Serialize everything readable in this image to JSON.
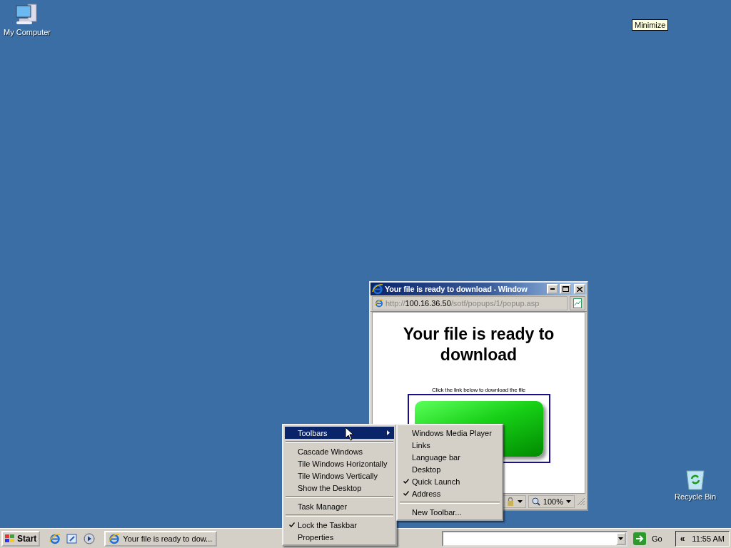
{
  "desktop_icons": [
    {
      "label": "My Computer",
      "kind": "computer"
    },
    {
      "label": "Recycle Bin",
      "kind": "recycle"
    }
  ],
  "tooltip": {
    "text": "Minimize"
  },
  "popup_window": {
    "title": "Your file is ready to download - Window",
    "address": "http://**100.16.36.50**/sotf/popups/1/popup.asp",
    "heading": "Your file is ready to download",
    "instruction": "Click the link below to download the file",
    "zoom": "100%"
  },
  "context_menu": {
    "items": [
      {
        "kind": "item",
        "label": "Toolbars",
        "selected": true,
        "checked": false,
        "submenu": true
      },
      {
        "kind": "separator"
      },
      {
        "kind": "item",
        "label": "Cascade Windows",
        "selected": false,
        "checked": false,
        "submenu": false
      },
      {
        "kind": "item",
        "label": "Tile Windows Horizontally",
        "selected": false,
        "checked": false,
        "submenu": false
      },
      {
        "kind": "item",
        "label": "Tile Windows Vertically",
        "selected": false,
        "checked": false,
        "submenu": false
      },
      {
        "kind": "item",
        "label": "Show the Desktop",
        "selected": false,
        "checked": false,
        "submenu": false
      },
      {
        "kind": "separator"
      },
      {
        "kind": "item",
        "label": "Task Manager",
        "selected": false,
        "checked": false,
        "submenu": false
      },
      {
        "kind": "separator"
      },
      {
        "kind": "item",
        "label": "Lock the Taskbar",
        "selected": false,
        "checked": true,
        "submenu": false
      },
      {
        "kind": "item",
        "label": "Properties",
        "selected": false,
        "checked": false,
        "submenu": false
      }
    ]
  },
  "toolbars_submenu": {
    "items": [
      {
        "kind": "item",
        "label": "Windows Media Player",
        "selected": false,
        "checked": false
      },
      {
        "kind": "item",
        "label": "Links",
        "selected": false,
        "checked": false
      },
      {
        "kind": "item",
        "label": "Language bar",
        "selected": false,
        "checked": false
      },
      {
        "kind": "item",
        "label": "Desktop",
        "selected": false,
        "checked": false
      },
      {
        "kind": "item",
        "label": "Quick Launch",
        "selected": false,
        "checked": true
      },
      {
        "kind": "item",
        "label": "Address",
        "selected": false,
        "checked": true
      },
      {
        "kind": "separator"
      },
      {
        "kind": "item",
        "label": "New Toolbar...",
        "selected": false,
        "checked": false
      }
    ]
  },
  "taskbar": {
    "start": "Start",
    "quick_launch": [
      {
        "kind": "browser"
      },
      {
        "kind": "desktop"
      },
      {
        "kind": "media"
      }
    ],
    "tasks": [
      {
        "label": "Your file is ready to dow...",
        "selected": false
      }
    ],
    "address_go": "Go",
    "tray_expand": "«",
    "clock": "11:55 AM"
  }
}
